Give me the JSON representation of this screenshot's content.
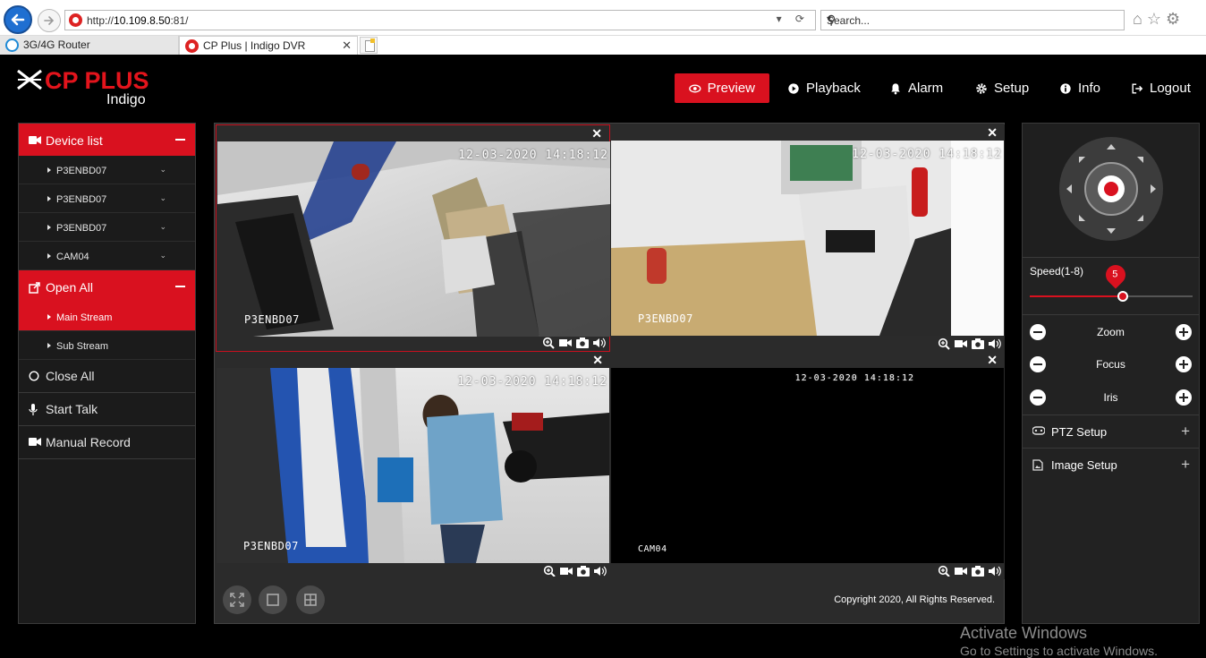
{
  "browser": {
    "url_prefix": "http://",
    "url_host": "10.109.8.50",
    "url_suffix": ":81/",
    "search_placeholder": "Search...",
    "tabs": [
      {
        "label": "3G/4G Router"
      },
      {
        "label": "CP Plus | Indigo DVR"
      }
    ]
  },
  "header": {
    "brand": "CP PLUS",
    "product": "Indigo",
    "nav": [
      {
        "label": "Preview",
        "icon": "eye-icon"
      },
      {
        "label": "Playback",
        "icon": "play-circle-icon"
      },
      {
        "label": "Alarm",
        "icon": "bell-icon"
      },
      {
        "label": "Setup",
        "icon": "gear-icon"
      },
      {
        "label": "Info",
        "icon": "info-icon"
      },
      {
        "label": "Logout",
        "icon": "logout-icon"
      }
    ]
  },
  "sidebar": {
    "device_list_title": "Device list",
    "devices": [
      {
        "label": "P3ENBD07"
      },
      {
        "label": "P3ENBD07"
      },
      {
        "label": "P3ENBD07"
      },
      {
        "label": "CAM04"
      }
    ],
    "open_all_title": "Open All",
    "streams": [
      {
        "label": "Main Stream"
      },
      {
        "label": "Sub Stream"
      }
    ],
    "close_all": "Close All",
    "start_talk": "Start Talk",
    "manual_record": "Manual Record"
  },
  "video": {
    "cells": [
      {
        "name": "P3ENBD07",
        "timestamp": "12-03-2020 14:18:12"
      },
      {
        "name": "P3ENBD07",
        "timestamp": "12-03-2020 14:18:12"
      },
      {
        "name": "P3ENBD07",
        "timestamp": "12-03-2020 14:18:12"
      },
      {
        "name": "CAM04",
        "timestamp": "12-03-2020 14:18:12"
      }
    ],
    "copyright": "Copyright 2020, All Rights Reserved."
  },
  "ptz": {
    "speed_label": "Speed(1-8)",
    "speed_value": "5",
    "speed_min": 1,
    "speed_max": 8,
    "zoom": "Zoom",
    "focus": "Focus",
    "iris": "Iris",
    "ptz_setup": "PTZ Setup",
    "image_setup": "Image Setup"
  },
  "watermark": {
    "line1": "Activate Windows",
    "line2": "Go to Settings to activate Windows."
  },
  "colors": {
    "accent": "#d9111f",
    "background": "#000000",
    "panel": "#1b1b1b"
  }
}
